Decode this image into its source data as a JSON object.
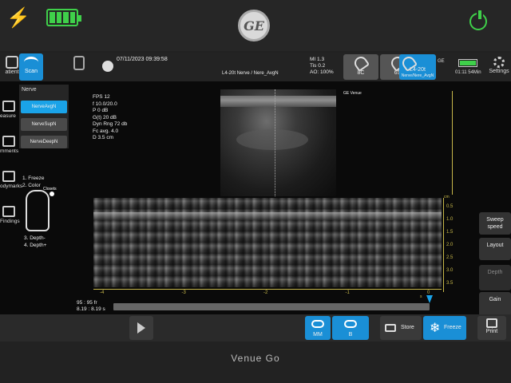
{
  "device": {
    "brand_logo": "GE",
    "model": "Venue Go"
  },
  "hardware_icons": [
    "plug-icon",
    "battery-full-icon",
    "power-icon"
  ],
  "colors": {
    "accent": "#1a8fd6",
    "indicator_green": "#3fd04a",
    "scale_yellow": "#c8b84a"
  },
  "topbar": {
    "patient_label": "atient",
    "scan_label": "Scan",
    "datetime": "07/11/2023 09:39:58",
    "probe_freq": "L4-20t   Nerve / Nere_AvgN",
    "mi": "MI 1.3",
    "tis": "Tis 0.2",
    "ao": "AO: 100%",
    "probes": [
      {
        "label": "8C",
        "active": false
      },
      {
        "label": "6S",
        "active": false
      },
      {
        "label": "L4-20t",
        "sub": "Nerve/Nere_AvgN",
        "active": true
      }
    ],
    "status": {
      "network": "GE",
      "time": "01:11 54Min"
    },
    "settings_label": "Settings"
  },
  "sidebar": {
    "items": [
      {
        "label": "easure",
        "icon": "ruler-icon"
      },
      {
        "label": "mments",
        "icon": "comment-icon"
      },
      {
        "label": "odymarks",
        "icon": "bodymark-icon"
      },
      {
        "label": "Findings",
        "icon": "clipboard-icon"
      }
    ]
  },
  "preset_panel": {
    "title": "Nerve",
    "buttons": [
      {
        "label": "NerveAvgN",
        "active": true
      },
      {
        "label": "NerveSupN",
        "active": false
      },
      {
        "label": "NerveDeepN",
        "active": false
      }
    ]
  },
  "probe_diagram": {
    "knobs_top": [
      "1. Freeze",
      "2. Color"
    ],
    "tag": "Closets",
    "knobs_bottom": [
      "3. Depth-",
      "4. Depth+"
    ]
  },
  "params": [
    "FPS 12",
    "f 10.0/20.0",
    "P 0 dB",
    "G(t) 20 dB",
    "Dyn Rng 72 db",
    "Fc avg. 4.0",
    "D 3.5 cm"
  ],
  "orientation_mark": "GE Venue",
  "mmode": {
    "depth_unit": "cm",
    "depth_ticks": [
      "0.5",
      "1.0",
      "1.5",
      "2.0",
      "2.5",
      "3.0",
      "3.5"
    ],
    "time_ticks": [
      "-4",
      "-3",
      "-2",
      "-1",
      "0"
    ],
    "time_unit": "s"
  },
  "cine": {
    "frames": "95 : 95 fr",
    "time": "8.19 : 8.19 s",
    "position_fraction": 1.0
  },
  "right_panel": [
    {
      "label": "Sweep speed",
      "enabled": true
    },
    {
      "label": "Layout",
      "enabled": true
    },
    {
      "label": "Depth",
      "enabled": false
    },
    {
      "label": "Gain",
      "enabled": true
    }
  ],
  "bottombar": {
    "mm_label": "MM",
    "b_label": "B",
    "store_label": "Store",
    "freeze_label": "Freeze",
    "print_label": "Print"
  }
}
